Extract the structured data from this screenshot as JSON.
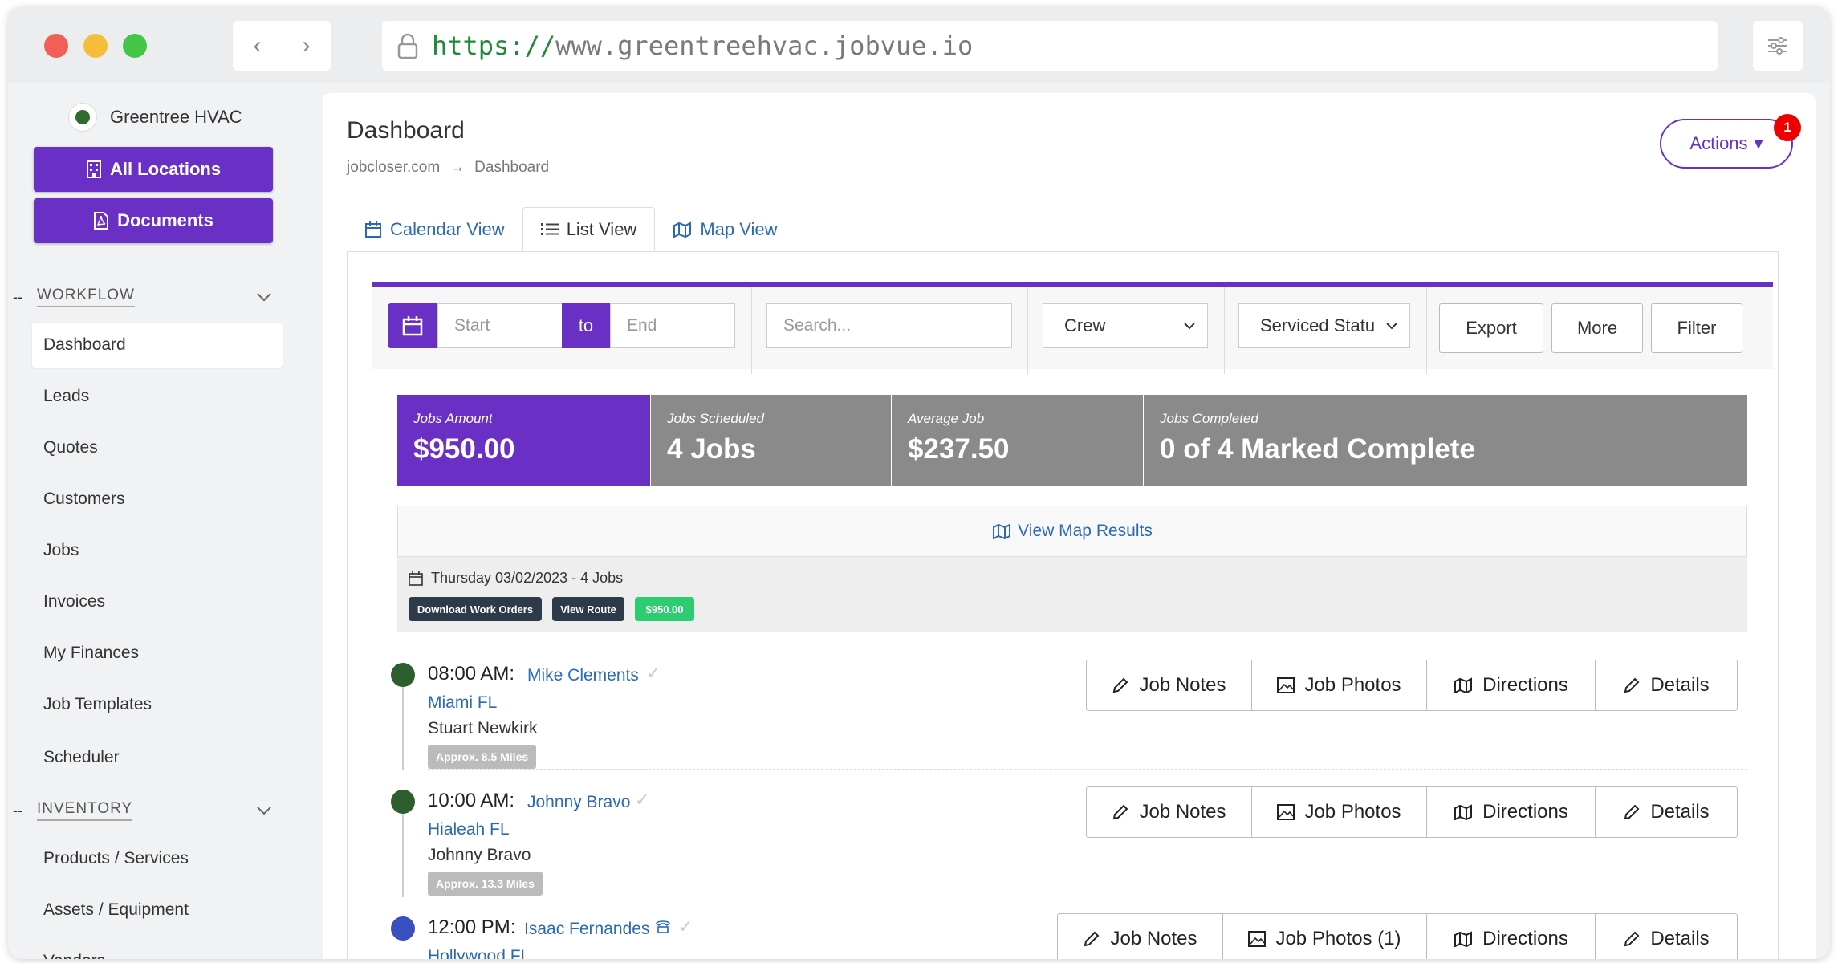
{
  "browser": {
    "url_scheme": "https://",
    "url_host": "www.greentreehvac.jobvue.io"
  },
  "sidebar": {
    "company_name": "Greentree HVAC",
    "all_locations_label": "All Locations",
    "documents_label": "Documents",
    "workflow_section": "WORKFLOW",
    "inventory_section": "INVENTORY",
    "workflow_items": [
      "Dashboard",
      "Leads",
      "Quotes",
      "Customers",
      "Jobs",
      "Invoices",
      "My Finances",
      "Job Templates",
      "Scheduler"
    ],
    "inventory_items": [
      "Products / Services",
      "Assets / Equipment",
      "Vendors"
    ],
    "active_item": "Dashboard"
  },
  "header": {
    "title": "Dashboard",
    "breadcrumb": [
      "jobcloser.com",
      "Dashboard"
    ],
    "actions_label": "Actions",
    "actions_badge": "1"
  },
  "tabs": [
    "Calendar View",
    "List View",
    "Map View"
  ],
  "active_tab": "List View",
  "toolbar": {
    "start_placeholder": "Start",
    "to_label": "to",
    "end_placeholder": "End",
    "search_placeholder": "Search...",
    "crew_select": "Crew",
    "status_select": "Serviced Statu",
    "export_label": "Export",
    "more_label": "More",
    "filter_label": "Filter"
  },
  "stats": [
    {
      "label": "Jobs Amount",
      "value": "$950.00"
    },
    {
      "label": "Jobs Scheduled",
      "value": "4 Jobs"
    },
    {
      "label": "Average Job",
      "value": "$237.50"
    },
    {
      "label": "Jobs Completed",
      "value": "0 of 4 Marked Complete"
    }
  ],
  "map_results_label": "View Map Results",
  "day": {
    "title": "Thursday 03/02/2023 - 4 Jobs",
    "download_label": "Download Work Orders",
    "route_label": "View Route",
    "amount_label": "$950.00"
  },
  "jobs": [
    {
      "time": "08:00 AM:",
      "customer": "Mike Clements",
      "location": "Miami FL",
      "tech": "Stuart Newkirk",
      "miles": "Approx. 8.5 Miles",
      "notes": "Job Notes",
      "photos": "Job Photos",
      "directions": "Directions",
      "details": "Details",
      "status_color": "#2e5e2e"
    },
    {
      "time": "10:00 AM:",
      "customer": "Johnny Bravo",
      "location": "Hialeah FL",
      "tech": "Johnny Bravo",
      "miles": "Approx. 13.3 Miles",
      "notes": "Job Notes",
      "photos": "Job Photos",
      "directions": "Directions",
      "details": "Details",
      "status_color": "#2e5e2e"
    },
    {
      "time": "12:00 PM:",
      "customer": "Isaac Fernandes",
      "location": "Hollywood FL",
      "tech": "",
      "miles": "",
      "notes": "Job Notes",
      "photos": "Job Photos (1)",
      "directions": "Directions",
      "details": "Details",
      "status_color": "#3a4fc0"
    }
  ],
  "colors": {
    "brand": "#6a2fc4",
    "link": "#2b6ab3",
    "stat_gray": "#8a8a8a",
    "chip_dark": "#2d3a4a",
    "chip_green": "#2ecc71"
  }
}
